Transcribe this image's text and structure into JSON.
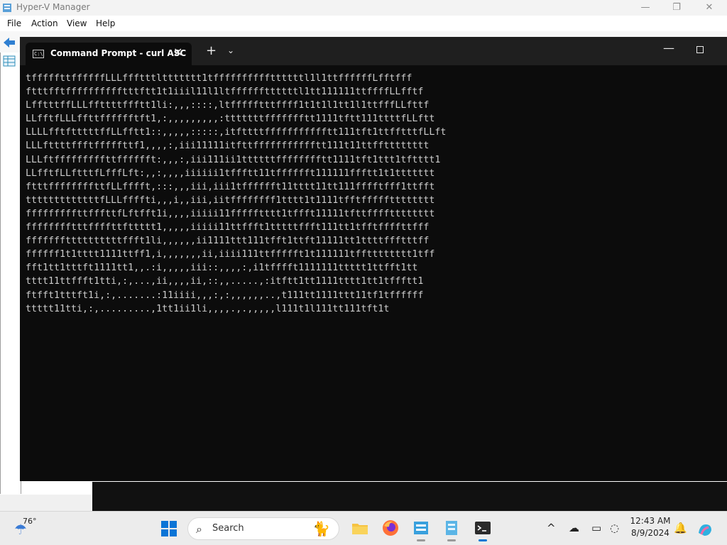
{
  "hyperv": {
    "title": "Hyper-V Manager",
    "menu": [
      "File",
      "Action",
      "View",
      "Help"
    ],
    "controls": {
      "minimize": "—",
      "restore": "❐",
      "close": "✕"
    }
  },
  "terminal": {
    "tab_title": "Command Prompt - curl  ASC",
    "tab_icon_text": "C:\\",
    "close_glyph": "✕",
    "new_tab_glyph": "+",
    "dropdown_glyph": "⌄",
    "minimize_glyph": "—",
    "output_lines": [
      "tfffffttffffffLLLffftttlttttttt1tffffffffffttttttl1l1ttffffffLfftfff",
      "ftttfftfffffffffftttftt1t1iiil11l1ltffffffttttttl1tt111111ttffffLLfftf",
      "LfftttffLLLffttttffftt1li:,,,::::,ltffffftttffff1t1t1l1tt1l1ttfffLLfttf",
      "LLfftfLLLffttfffffftft1,:,,,,,,,,,:tttttttffffffftt1111tftt111ttttfLLftt",
      "LLLLfftftttttffLLfftt1::,,,,,:::::,itfttttffffffffffftt111tft1ttfftttfLLft",
      "LLLfttttffftfffffttf1,,,,:,iii11111itfttffffffffffftt111t11ttfftttttttt",
      "LLLftfffffffffttfffffft:,,,:,iii111ii1ttttttfffffffftt1111tft1ttt1tftttt1",
      "LLfftfLLftttfLfffLft:,,:,,,,iiiiii1tffftt11tfffffft111111ffftt1t1ttttttt",
      "ftttffffffffttfLLfffft,:::,,,iii,iii1tfffffft11tttt11tt111fffftfff1ttfft",
      "tttttttttttttfLLLffffti,,,i,,iii,iitffffffff1tttt1t1111tfftffffftttttttt",
      "fffffffffttfffttfLftfft1i,,,,iiiii11ffffftttt1tffft11111tfttfffftttttttt",
      "fffffffftttffffttfttttt1,,,,,iiiii11ttffft1tttttffft111tt1tfftffffttfff",
      "fffffffttttttttttffft1li,,,,,,ii1111ttt111tfft1ttft11111tt1ttttffftttff",
      "ffffff1t1tttt1111ttff1,i,,,,,,,ii,iiii111ttffffft1t111111tfftttttttt1tff",
      "fft1tt1tttft1111tt1,,.:i,,,,,iii::,,,,:,i1tfffft1111111ttttt1ttfft1tt",
      "tttt11ttffft1tti,:,...,ii,,,,ii,::,,.....,:itftt1tt1111tttt1tt1tffftt1",
      "ftfft1tttft1i,:,.......:11iiii,,,:,:,,,,,,..,t111tt1111ttt11tf1tffffff",
      "ttttt11tti,:,.........,1tt1ii1li,,,,.,.,,,,,l111t1l111tt111tft1t"
    ]
  },
  "taskbar": {
    "weather_temp": "76°",
    "search_placeholder": "Search",
    "clock_time": "12:43 AM",
    "clock_date": "8/9/2024"
  },
  "icons": {
    "start": "windows-logo-icon",
    "search": "search-icon",
    "file_explorer": "folder-icon",
    "firefox": "firefox-icon",
    "hyperv_a": "hyper-v-icon",
    "hyperv_b": "hyper-v-manager-icon",
    "terminal": "terminal-icon",
    "copilot": "copilot-icon"
  },
  "colors": {
    "terminal_bg": "#0c0c0c",
    "terminal_text": "#cccccc",
    "tabbar_bg": "#1f1f1f",
    "taskbar_bg": "#ececec",
    "accent": "#0078d4"
  }
}
